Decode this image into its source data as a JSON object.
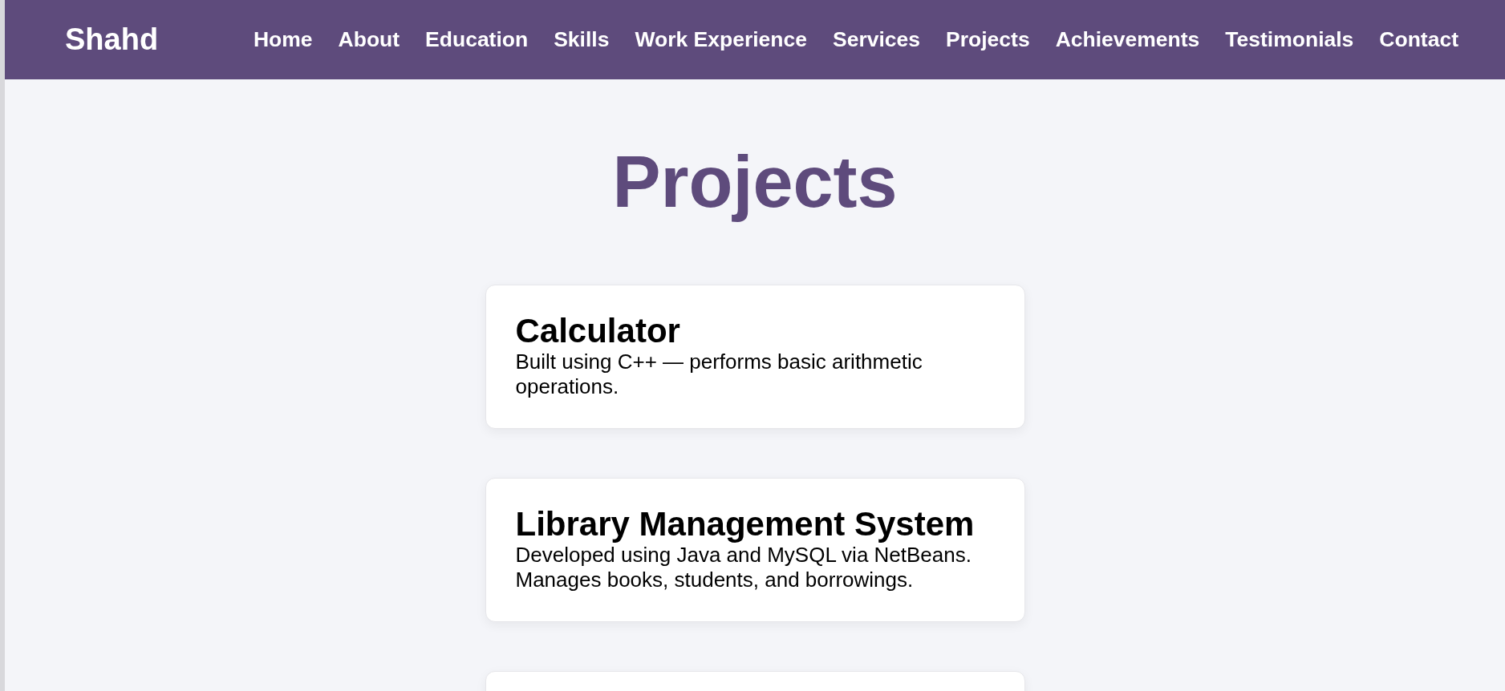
{
  "navbar": {
    "brand": "Shahd",
    "links": [
      {
        "label": "Home"
      },
      {
        "label": "About"
      },
      {
        "label": "Education"
      },
      {
        "label": "Skills"
      },
      {
        "label": "Work Experience"
      },
      {
        "label": "Services"
      },
      {
        "label": "Projects"
      },
      {
        "label": "Achievements"
      },
      {
        "label": "Testimonials"
      },
      {
        "label": "Contact"
      }
    ]
  },
  "section": {
    "title": "Projects",
    "projects": [
      {
        "name": "Calculator",
        "description": "Built using C++ — performs basic arithmetic operations."
      },
      {
        "name": "Library Management System",
        "description": "Developed using Java and MySQL via NetBeans. Manages books, students, and borrowings."
      }
    ]
  }
}
